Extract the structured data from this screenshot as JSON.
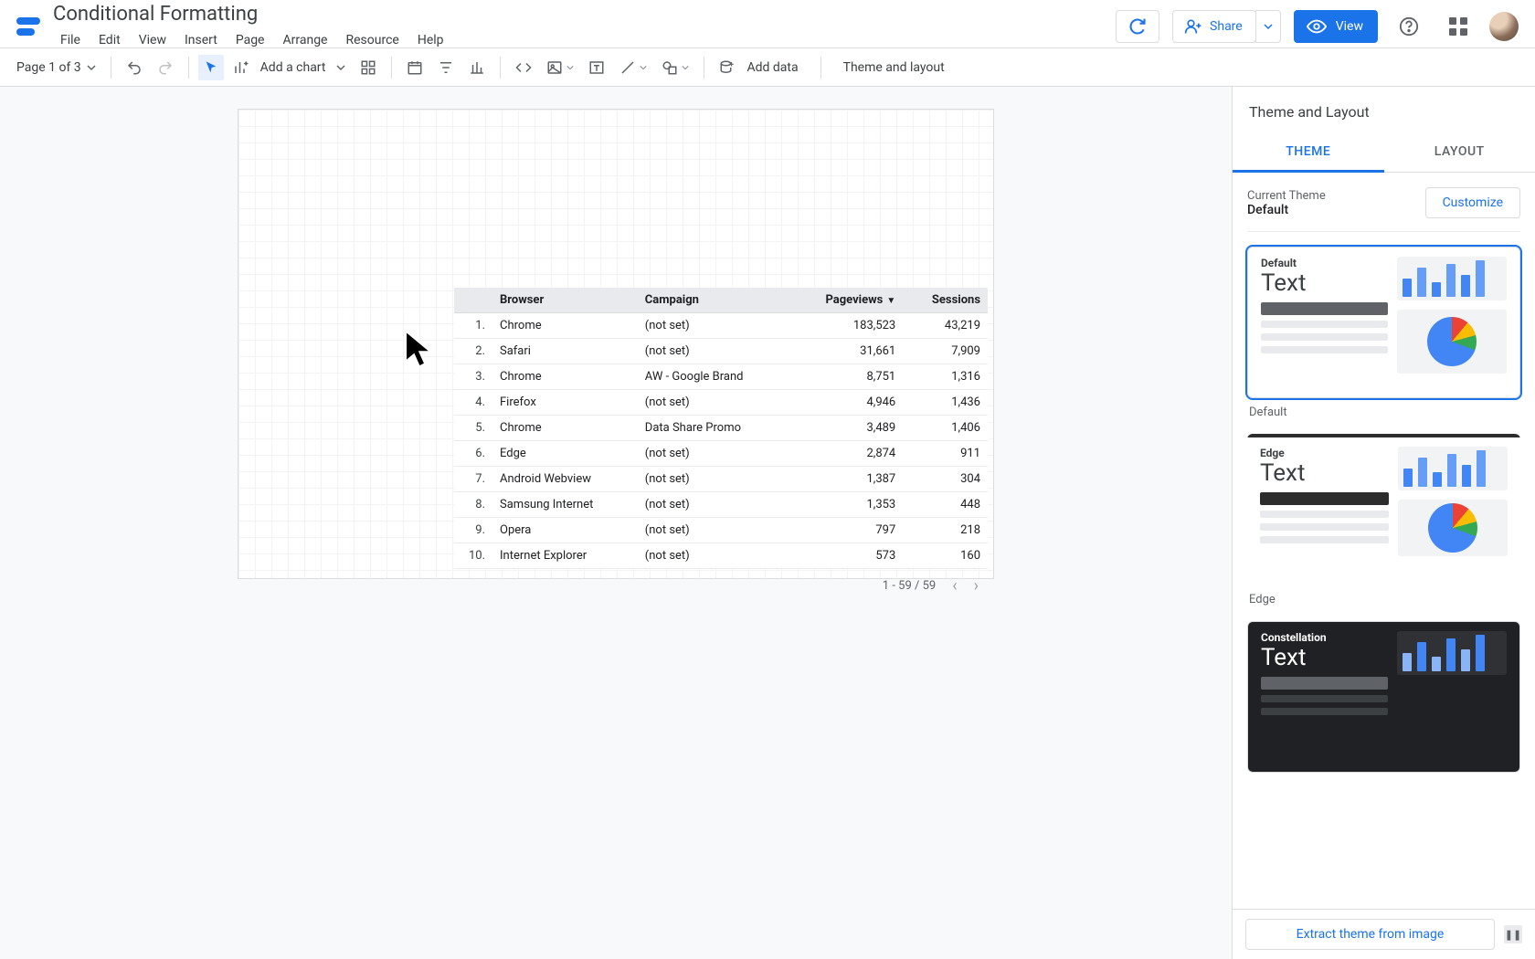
{
  "header": {
    "doc_title": "Conditional Formatting",
    "menu": [
      "File",
      "Edit",
      "View",
      "Insert",
      "Page",
      "Arrange",
      "Resource",
      "Help"
    ],
    "refresh_icon": "refresh-icon",
    "share_label": "Share",
    "view_label": "View"
  },
  "toolbar": {
    "page_label": "Page 1 of 3",
    "add_chart_label": "Add a chart",
    "add_data_label": "Add data",
    "theme_layout_label": "Theme and layout"
  },
  "chart_data": {
    "type": "table",
    "columns": [
      "Browser",
      "Campaign",
      "Pageviews",
      "Sessions"
    ],
    "sort_column": "Pageviews",
    "sort_dir": "desc",
    "rows": [
      {
        "idx": "1.",
        "browser": "Chrome",
        "campaign": "(not set)",
        "pageviews": "183,523",
        "sessions": "43,219"
      },
      {
        "idx": "2.",
        "browser": "Safari",
        "campaign": "(not set)",
        "pageviews": "31,661",
        "sessions": "7,909"
      },
      {
        "idx": "3.",
        "browser": "Chrome",
        "campaign": "AW - Google Brand",
        "pageviews": "8,751",
        "sessions": "1,316"
      },
      {
        "idx": "4.",
        "browser": "Firefox",
        "campaign": "(not set)",
        "pageviews": "4,946",
        "sessions": "1,436"
      },
      {
        "idx": "5.",
        "browser": "Chrome",
        "campaign": "Data Share Promo",
        "pageviews": "3,489",
        "sessions": "1,406"
      },
      {
        "idx": "6.",
        "browser": "Edge",
        "campaign": "(not set)",
        "pageviews": "2,874",
        "sessions": "911"
      },
      {
        "idx": "7.",
        "browser": "Android Webview",
        "campaign": "(not set)",
        "pageviews": "1,387",
        "sessions": "304"
      },
      {
        "idx": "8.",
        "browser": "Samsung Internet",
        "campaign": "(not set)",
        "pageviews": "1,353",
        "sessions": "448"
      },
      {
        "idx": "9.",
        "browser": "Opera",
        "campaign": "(not set)",
        "pageviews": "797",
        "sessions": "218"
      },
      {
        "idx": "10.",
        "browser": "Internet Explorer",
        "campaign": "(not set)",
        "pageviews": "573",
        "sessions": "160"
      }
    ],
    "pager_text": "1 - 59 / 59"
  },
  "panel": {
    "title": "Theme and Layout",
    "tab_theme": "THEME",
    "tab_layout": "LAYOUT",
    "current_theme_label": "Current Theme",
    "current_theme_name": "Default",
    "customize_label": "Customize",
    "themes": [
      {
        "name": "Default",
        "title": "Default",
        "text": "Text"
      },
      {
        "name": "Edge",
        "title": "Edge",
        "text": "Text"
      },
      {
        "name": "Constellation",
        "title": "Constellation",
        "text": "Text"
      }
    ],
    "extract_label": "Extract theme from image"
  }
}
